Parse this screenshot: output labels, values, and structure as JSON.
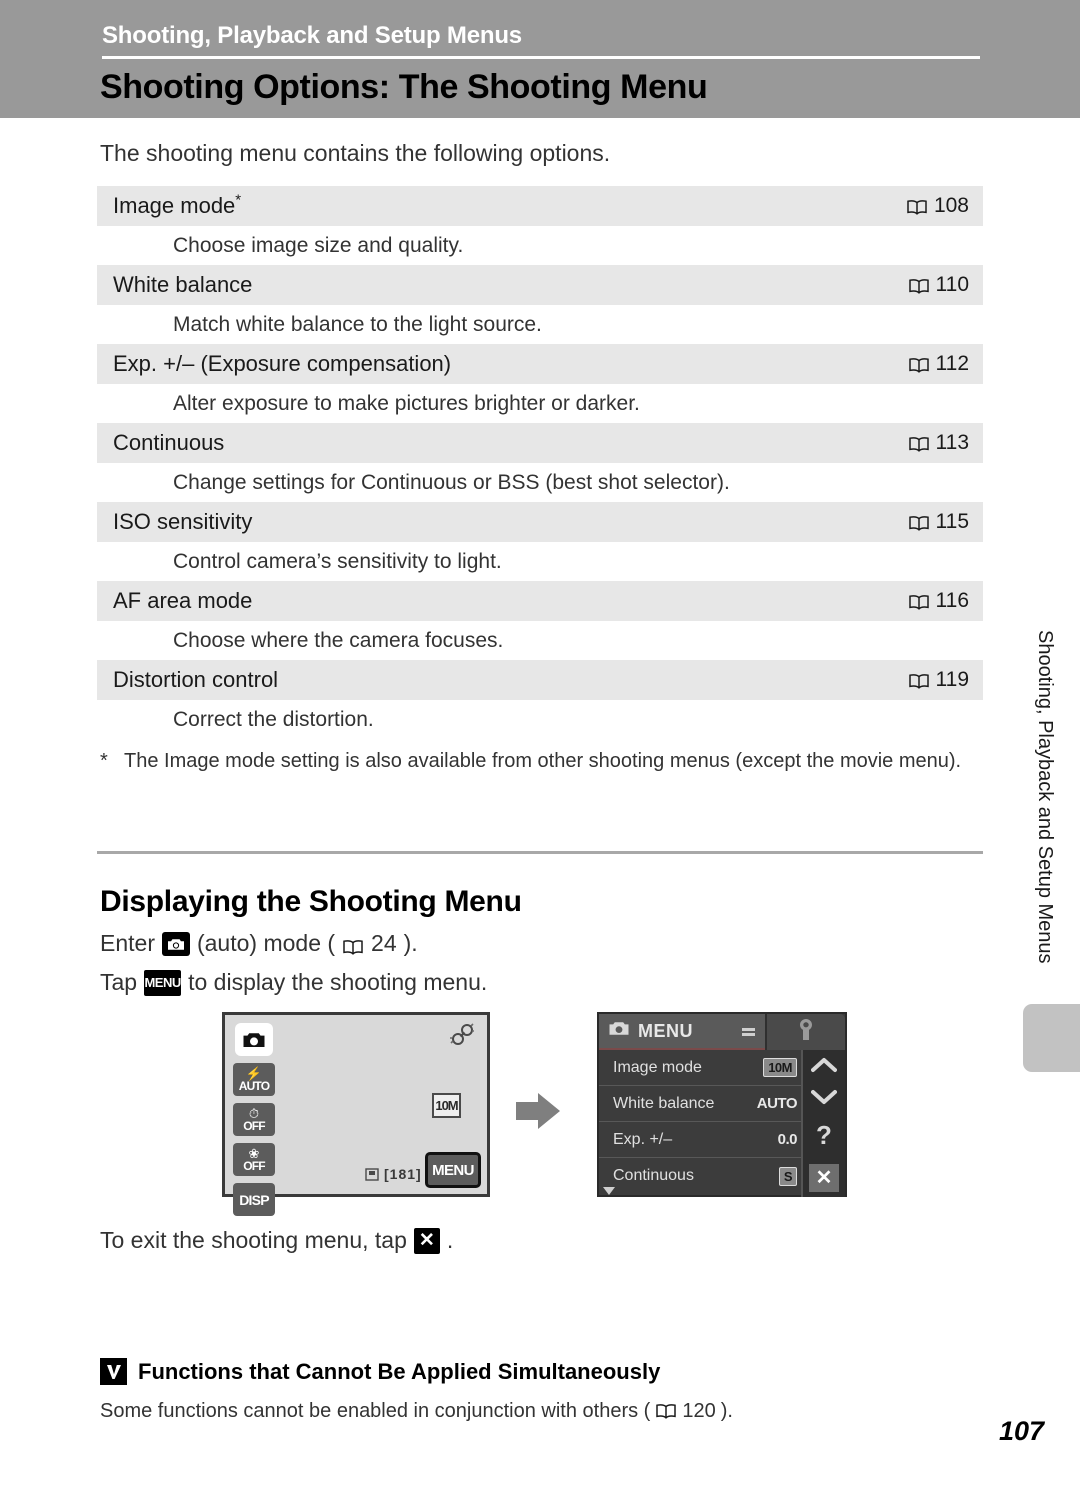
{
  "header": {
    "chapter": "Shooting, Playback and Setup Menus",
    "title": "Shooting Options: The Shooting Menu"
  },
  "intro": "The shooting menu contains the following options.",
  "options_table": {
    "rows": [
      {
        "name": "Image mode",
        "star": "*",
        "ref": "108",
        "desc": "Choose image size and quality."
      },
      {
        "name": "White balance",
        "star": "",
        "ref": "110",
        "desc": "Match white balance to the light source."
      },
      {
        "name": "Exp. +/– (Exposure compensation)",
        "star": "",
        "ref": "112",
        "desc": "Alter exposure to make pictures brighter or darker."
      },
      {
        "name": "Continuous",
        "star": "",
        "ref": "113",
        "desc": "Change settings for Continuous or BSS (best shot selector)."
      },
      {
        "name": "ISO sensitivity",
        "star": "",
        "ref": "115",
        "desc": "Control camera’s sensitivity to light."
      },
      {
        "name": "AF area mode",
        "star": "",
        "ref": "116",
        "desc": "Choose where the camera focuses."
      },
      {
        "name": "Distortion control",
        "star": "",
        "ref": "119",
        "desc": "Correct the distortion."
      }
    ]
  },
  "footnote": {
    "mark": "*",
    "text": "The Image mode setting is also available from other shooting menus (except the movie menu)."
  },
  "subsection": {
    "heading": "Displaying the Shooting Menu",
    "step1_before": "Enter",
    "step1_mid": "(auto) mode (",
    "step1_ref": "24",
    "step1_after": ").",
    "step2_before": "Tap",
    "step2_menu_label": "MENU",
    "step2_after": "to display the shooting menu.",
    "exit_before": "To exit the shooting menu, tap",
    "exit_after": "."
  },
  "figure": {
    "shooting_screen": {
      "mode_icon": "camera-icon",
      "shake_icon": "vibration-reduction-icon",
      "image_mode_badge": "10M",
      "buttons": [
        {
          "glyph": "⚡",
          "label": "AUTO",
          "name": "flash-auto-button"
        },
        {
          "glyph": "⏱",
          "label": "OFF",
          "name": "self-timer-off-button"
        },
        {
          "glyph": "❀",
          "label": "OFF",
          "name": "macro-off-button"
        },
        {
          "glyph": "",
          "label": "DISP",
          "name": "display-button"
        }
      ],
      "frame_counter": "[181]",
      "menu_button": "MENU"
    },
    "arrow": "right-arrow",
    "menu_screen": {
      "tab_title": "MENU",
      "tab_camera_icon": "camera-icon",
      "tab_setup_icon": "wrench-icon",
      "rows": [
        {
          "label": "Image mode",
          "value": "10M",
          "boxed": true
        },
        {
          "label": "White balance",
          "value": "AUTO",
          "boxed": false
        },
        {
          "label": "Exp. +/–",
          "value": "0.0",
          "boxed": false
        },
        {
          "label": "Continuous",
          "value": "S",
          "boxed": true
        }
      ],
      "side_icons": {
        "up": "chevron-up-icon",
        "down": "chevron-down-icon",
        "help": "?",
        "close": "✕"
      }
    }
  },
  "bottom_note": {
    "title": "Functions that Cannot Be Applied Simultaneously",
    "body_before": "Some functions cannot be enabled in conjunction with others (",
    "body_ref": "120",
    "body_after": ")."
  },
  "side_tab": {
    "text": "Shooting, Playback and Setup Menus"
  },
  "page_number": "107",
  "colors": {
    "header_band": "#999999",
    "row_gray": "#e7e7e7",
    "lcd_bg": "#d9d9d9",
    "menu_bg": "#3c3c3c",
    "side_tab": "#c2c2c2"
  }
}
